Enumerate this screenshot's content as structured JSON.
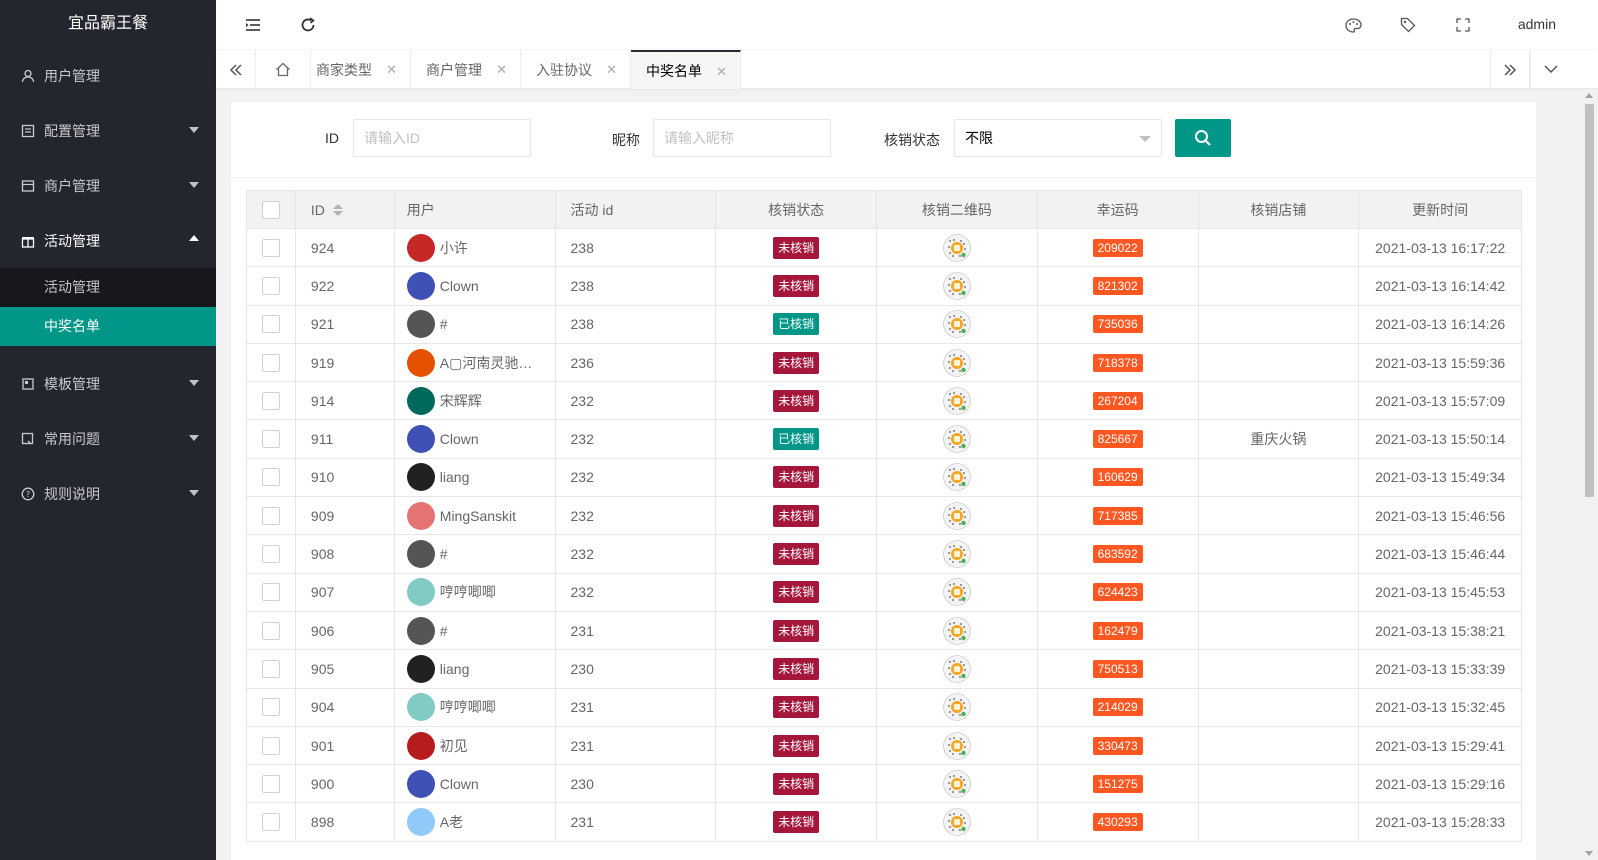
{
  "app": {
    "title": "宜品霸王餐"
  },
  "sidebar": {
    "items": [
      {
        "label": "用户管理",
        "icon": "user-icon"
      },
      {
        "label": "配置管理",
        "icon": "config-icon"
      },
      {
        "label": "商户管理",
        "icon": "shop-icon"
      },
      {
        "label": "活动管理",
        "icon": "gift-icon",
        "open": true
      },
      {
        "label": "模板管理",
        "icon": "template-icon"
      },
      {
        "label": "常用问题",
        "icon": "faq-icon"
      },
      {
        "label": "规则说明",
        "icon": "help-icon"
      }
    ],
    "submenu": [
      {
        "label": "活动管理"
      },
      {
        "label": "中奖名单",
        "active": true
      }
    ]
  },
  "header": {
    "user": "admin"
  },
  "tabs": [
    {
      "label": "商家类型"
    },
    {
      "label": "商户管理"
    },
    {
      "label": "入驻协议"
    },
    {
      "label": "中奖名单",
      "active": true
    }
  ],
  "search": {
    "id_label": "ID",
    "id_placeholder": "请输入ID",
    "nick_label": "昵称",
    "nick_placeholder": "请输入昵称",
    "status_label": "核销状态",
    "status_value": "不限"
  },
  "table": {
    "columns": [
      "ID",
      "用户",
      "活动 id",
      "核销状态",
      "核销二维码",
      "幸运码",
      "核销店铺",
      "更新时间"
    ],
    "rows": [
      {
        "id": "924",
        "user": "小许",
        "activity": "238",
        "status": "未核销",
        "verified": false,
        "code": "209022",
        "store": "",
        "time": "2021-03-13 16:17:22",
        "avatar": "#c62828"
      },
      {
        "id": "922",
        "user": "Clown",
        "activity": "238",
        "status": "未核销",
        "verified": false,
        "code": "821302",
        "store": "",
        "time": "2021-03-13 16:14:42",
        "avatar": "#3f51b5"
      },
      {
        "id": "921",
        "user": "#",
        "activity": "238",
        "status": "已核销",
        "verified": true,
        "code": "735036",
        "store": "",
        "time": "2021-03-13 16:14:26",
        "avatar": "#555555"
      },
      {
        "id": "919",
        "user": "A▢河南灵驰…",
        "activity": "236",
        "status": "未核销",
        "verified": false,
        "code": "718378",
        "store": "",
        "time": "2021-03-13 15:59:36",
        "avatar": "#e65100"
      },
      {
        "id": "914",
        "user": "宋辉辉",
        "activity": "232",
        "status": "未核销",
        "verified": false,
        "code": "267204",
        "store": "",
        "time": "2021-03-13 15:57:09",
        "avatar": "#00695c"
      },
      {
        "id": "911",
        "user": "Clown",
        "activity": "232",
        "status": "已核销",
        "verified": true,
        "code": "825667",
        "store": "重庆火锅",
        "time": "2021-03-13 15:50:14",
        "avatar": "#3f51b5"
      },
      {
        "id": "910",
        "user": "liang",
        "activity": "232",
        "status": "未核销",
        "verified": false,
        "code": "160629",
        "store": "",
        "time": "2021-03-13 15:49:34",
        "avatar": "#212121"
      },
      {
        "id": "909",
        "user": "MingSanskit",
        "activity": "232",
        "status": "未核销",
        "verified": false,
        "code": "717385",
        "store": "",
        "time": "2021-03-13 15:46:56",
        "avatar": "#e57373"
      },
      {
        "id": "908",
        "user": "#",
        "activity": "232",
        "status": "未核销",
        "verified": false,
        "code": "683592",
        "store": "",
        "time": "2021-03-13 15:46:44",
        "avatar": "#555555"
      },
      {
        "id": "907",
        "user": "哼哼唧唧",
        "activity": "232",
        "status": "未核销",
        "verified": false,
        "code": "624423",
        "store": "",
        "time": "2021-03-13 15:45:53",
        "avatar": "#80cbc4"
      },
      {
        "id": "906",
        "user": "#",
        "activity": "231",
        "status": "未核销",
        "verified": false,
        "code": "162479",
        "store": "",
        "time": "2021-03-13 15:38:21",
        "avatar": "#555555"
      },
      {
        "id": "905",
        "user": "liang",
        "activity": "230",
        "status": "未核销",
        "verified": false,
        "code": "750513",
        "store": "",
        "time": "2021-03-13 15:33:39",
        "avatar": "#212121"
      },
      {
        "id": "904",
        "user": "哼哼唧唧",
        "activity": "231",
        "status": "未核销",
        "verified": false,
        "code": "214029",
        "store": "",
        "time": "2021-03-13 15:32:45",
        "avatar": "#80cbc4"
      },
      {
        "id": "901",
        "user": "初见",
        "activity": "231",
        "status": "未核销",
        "verified": false,
        "code": "330473",
        "store": "",
        "time": "2021-03-13 15:29:41",
        "avatar": "#b71c1c"
      },
      {
        "id": "900",
        "user": "Clown",
        "activity": "230",
        "status": "未核销",
        "verified": false,
        "code": "151275",
        "store": "",
        "time": "2021-03-13 15:29:16",
        "avatar": "#3f51b5"
      },
      {
        "id": "898",
        "user": "A老",
        "activity": "231",
        "status": "未核销",
        "verified": false,
        "code": "430293",
        "store": "",
        "time": "2021-03-13 15:28:33",
        "avatar": "#90caf9"
      }
    ]
  },
  "colors": {
    "accent": "#009688",
    "sidebar": "#23262e",
    "unverified": "#a4173b",
    "lucky": "#ff5722"
  }
}
